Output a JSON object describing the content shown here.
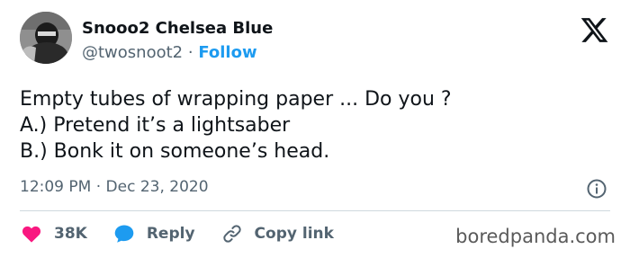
{
  "author": {
    "display_name": "Snooo2 Chelsea Blue",
    "handle": "@twosnoot2",
    "separator": "·",
    "follow_label": "Follow"
  },
  "tweet": {
    "lines": [
      "Empty tubes of wrapping paper ... Do you ?",
      "A.) Pretend it’s a lightsaber",
      "B.) Bonk it on someone’s head."
    ],
    "timestamp": "12:09 PM · Dec 23, 2020"
  },
  "actions": {
    "likes": "38K",
    "reply_label": "Reply",
    "copy_link_label": "Copy link"
  },
  "icons": {
    "platform_logo": "x-logo-icon",
    "like": "heart-icon",
    "reply": "speech-bubble-icon",
    "copy": "link-icon",
    "info": "info-icon"
  },
  "colors": {
    "accent": "#1d9bf0",
    "like": "#f91880",
    "text": "#0f1419",
    "secondary_text": "#536471"
  },
  "watermark": "boredpanda.com"
}
